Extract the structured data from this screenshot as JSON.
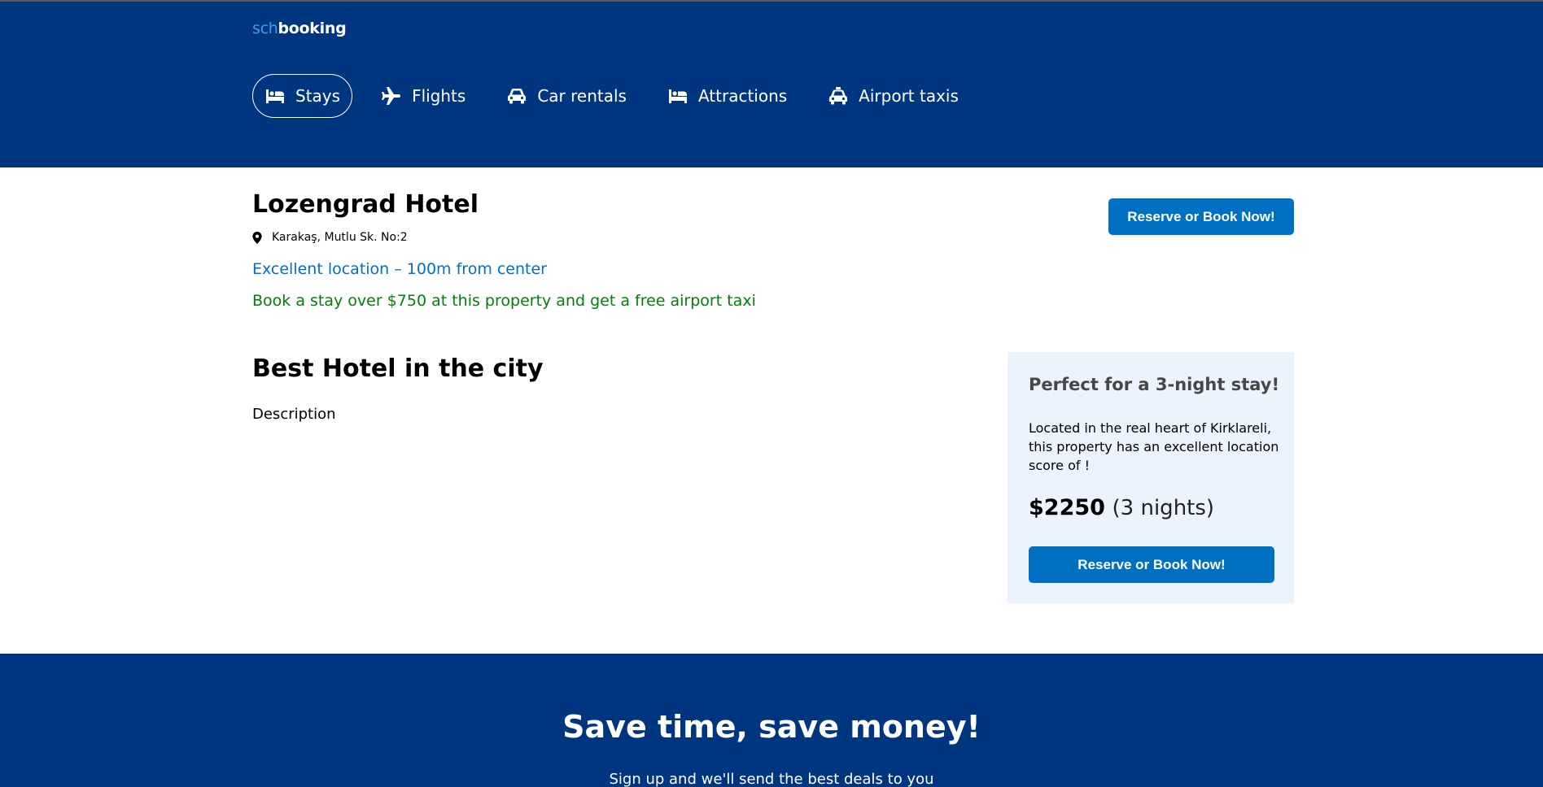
{
  "brand": {
    "prefix": "sch",
    "name": "booking"
  },
  "nav": {
    "items": [
      {
        "label": "Stays",
        "icon": "bed-icon"
      },
      {
        "label": "Flights",
        "icon": "plane-icon"
      },
      {
        "label": "Car rentals",
        "icon": "car-icon"
      },
      {
        "label": "Attractions",
        "icon": "bed-icon"
      },
      {
        "label": "Airport taxis",
        "icon": "taxi-icon"
      }
    ],
    "active": "Stays"
  },
  "hotel": {
    "name": "Lozengrad Hotel",
    "address": "Karakaş, Mutlu Sk. No:2",
    "location_note": "Excellent location – 100m from center",
    "promo": "Book a stay over $750 at this property and get a free airport taxi",
    "reserve_label": "Reserve or Book Now!"
  },
  "details": {
    "title": "Best Hotel in the city",
    "description": "Description"
  },
  "price_card": {
    "title": "Perfect for a 3-night stay!",
    "text": "Located in the real heart of Kirklareli, this property has an excellent location score of !",
    "price": "$2250",
    "nights": "(3 nights)",
    "reserve_label": "Reserve or Book Now!"
  },
  "footer": {
    "title": "Save time, save money!",
    "subtitle": "Sign up and we'll send the best deals to you"
  },
  "colors": {
    "header_bg": "#003580",
    "accent_blue": "#0071c2",
    "promo_green": "#008009",
    "card_bg": "#ebf3ff",
    "logo_accent": "#3e9ef5"
  }
}
